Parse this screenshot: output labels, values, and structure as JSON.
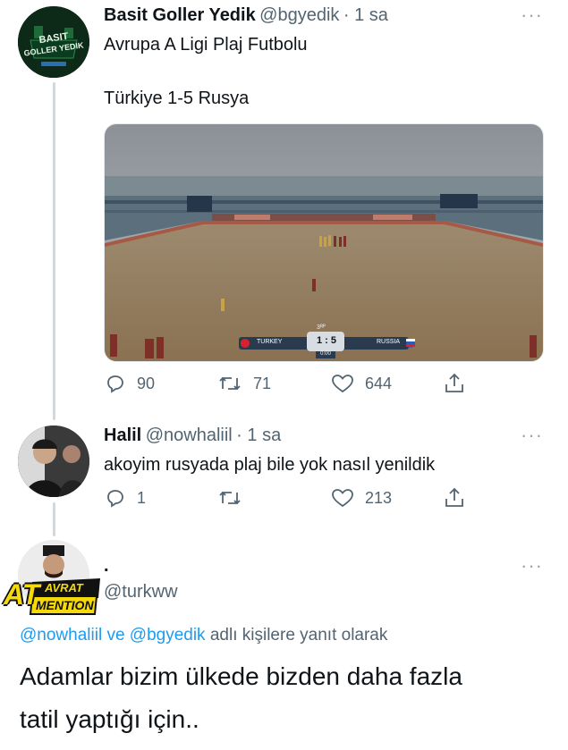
{
  "tweet1": {
    "author_name": "Basit Goller Yedik",
    "handle": "@bgyedik",
    "time": "· 1 sa",
    "line1": "Avrupa A Ligi Plaj Futbolu",
    "line2": "Türkiye 1-5 Rusya",
    "avatar_text_top": "BASIT",
    "avatar_text_bottom": "GOLLER YEDIK",
    "scoreboard": {
      "period": "3ᴿᴾ",
      "home": "TURKEY",
      "score": "1 : 5",
      "away": "RUSSIA",
      "clock": "0:00"
    },
    "replies": "90",
    "retweets": "71",
    "likes": "644"
  },
  "tweet2": {
    "author_name": "Halil",
    "handle": "@nowhaliil",
    "time": "· 1 sa",
    "text": "akoyim rusyada plaj bile yok nasıl yenildik",
    "replies": "1",
    "retweets": "",
    "likes": "213"
  },
  "tweet3": {
    "author_name": ".",
    "handle": "@turkww",
    "badge_line1": "AVRAT",
    "badge_line2": "MENTION",
    "badge_at": "AT",
    "reply_to_users": "@nowhaliil ve @bgyedik",
    "reply_to_suffix": "adlı kişilere yanıt olarak",
    "text_line1": "Adamlar bizim ülkede bizden daha fazla",
    "text_line2": "tatil yaptığı için.."
  },
  "colors": {
    "link": "#1d9bf0",
    "secondary": "#536471",
    "thread_line": "#cfd9de"
  },
  "icons": [
    "more-icon",
    "reply-icon",
    "retweet-icon",
    "like-icon",
    "share-icon"
  ]
}
